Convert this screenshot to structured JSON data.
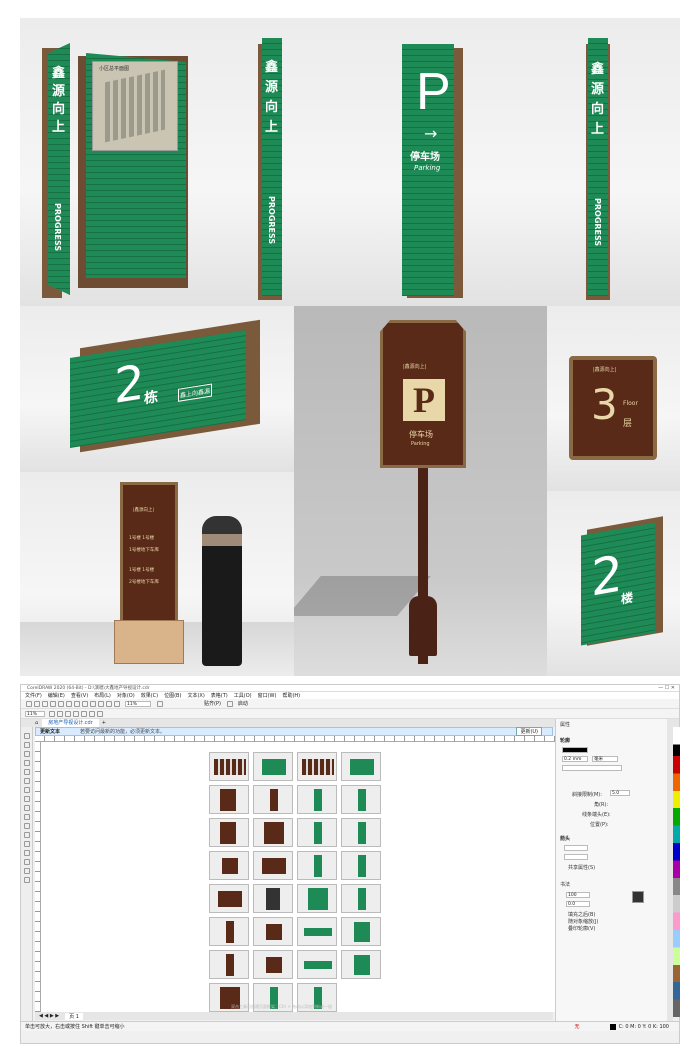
{
  "photos": {
    "p1": {
      "chars": [
        "鑫",
        "源",
        "向",
        "上"
      ],
      "brand": "PROGRESS",
      "map_title": "小区总平面图"
    },
    "p2": {
      "chars": [
        "鑫",
        "源",
        "向",
        "上"
      ],
      "brand": "PROGRESS"
    },
    "p3": {
      "letter": "P",
      "arrow": "→",
      "cn": "停车场",
      "en": "Parking"
    },
    "p4": {
      "chars": [
        "鑫",
        "源",
        "向",
        "上"
      ],
      "brand": "PROGRESS"
    },
    "p5": {
      "number": "2",
      "unit": "栋",
      "logo": "鑫上向鑫源"
    },
    "p6": {
      "logo": "|鑫源向上|",
      "letter": "P",
      "cn": "停车场",
      "en": "Parking"
    },
    "p7": {
      "logo": "|鑫源向上|",
      "number": "3",
      "en": "Floor",
      "cn": "层"
    },
    "p8": {
      "logo": "|鑫源向上|",
      "lines": [
        "1号楼 1号楼",
        "1号楼地下车库",
        "1号楼 1号楼",
        "2号楼地下车库"
      ]
    },
    "p9": {
      "number": "2",
      "unit": "楼"
    }
  },
  "app": {
    "title": "CorelDRAW 2020 (64-Bit) - D:\\演唱\\大鑫地产导视设计.cdr",
    "menu": [
      "文件(F)",
      "编辑(E)",
      "查看(V)",
      "布局(L)",
      "对象(O)",
      "效果(C)",
      "位图(B)",
      "文本(X)",
      "表格(T)",
      "工具(O)",
      "窗口(W)",
      "帮助(H)"
    ],
    "zoom": "11%",
    "snap_label": "贴齐(P)",
    "launch_label": "启动",
    "doc_tab": "房地产导视设计.cdr",
    "notice_title": "更新文本",
    "notice_text": "若要访问最新的功能，必须更新文本。",
    "notice_button": "更新(U)",
    "page_tab": "页 1",
    "status_left": "单击可放大，右击或按住 Shift 键单击可缩小",
    "fill_none": "无",
    "status_color": "C: 0 M: 0 Y: 0 K: 100",
    "page_note": "双击工具可创建页面框架；Ctrl + 拖动以添加到新或一组",
    "props": {
      "header": "属性",
      "outline": "轮廓",
      "width_val": "0.2 mm",
      "unit": "毫米",
      "miter_label": "斜接限制(M):",
      "miter_val": "5.0",
      "corner_label": "角(R):",
      "line_end_label": "线条端头(E):",
      "position_label": "位置(P):",
      "arrow_header": "箭头",
      "share_label": "共享属性(S)",
      "calligraphy": "书法",
      "stretch_val": "100",
      "angle_val": "0.0",
      "check1": "填充之后(B)",
      "check2": "随对象缩放(J)",
      "check3": "叠印轮廓(V)"
    }
  }
}
